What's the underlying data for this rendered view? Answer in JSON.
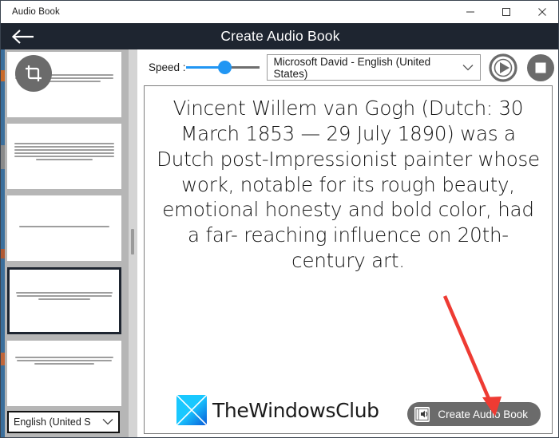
{
  "window": {
    "title": "Audio Book",
    "controls": {
      "minimize": "minimize-icon",
      "maximize": "maximize-icon",
      "close": "close-icon"
    }
  },
  "header": {
    "back_label": "back-arrow-icon",
    "title": "Create Audio Book"
  },
  "sidebar": {
    "crop_icon": "crop-icon",
    "thumbnails": [
      {
        "index": 1,
        "selected": false,
        "lines": [
          96,
          96,
          70
        ]
      },
      {
        "index": 2,
        "selected": false,
        "lines": [
          97,
          97,
          97,
          97,
          97,
          55
        ]
      },
      {
        "index": 3,
        "selected": false,
        "lines": [
          88
        ]
      },
      {
        "index": 4,
        "selected": true,
        "lines": [
          97,
          95,
          52
        ]
      },
      {
        "index": 5,
        "selected": false,
        "lines": [
          96,
          92,
          58
        ]
      }
    ],
    "language": {
      "value": "English (United S",
      "chevron": "chevron-down-icon"
    }
  },
  "toolbar": {
    "speed_label": "Speed :",
    "speed_value": 50,
    "voice": {
      "value": "Microsoft David - English (United States)",
      "chevron": "chevron-down-icon"
    },
    "play_button": "play-icon",
    "stop_button": "stop-icon"
  },
  "document": {
    "text": "Vincent Willem van Gogh (Dutch: 30 March 1853 — 29 July 1890) was a Dutch post-Impressionist painter whose work, notable for its rough beauty, emotional honesty and bold color, had a far- reaching influence on 20th-century art."
  },
  "footer": {
    "brand": "TheWindowsClub",
    "brand_logo": "thewindowsclub-logo",
    "create_button": {
      "label": "Create Audio Book",
      "icon": "audiobook-speaker-icon"
    },
    "annotation_arrow": "red-arrow-annotation"
  },
  "colors": {
    "header_bg": "#1e2530",
    "accent_blue": "#2196f3",
    "button_gray": "#6b6b6b",
    "arrow_red": "#ee3b33",
    "sidebar_bg": "#b6b6b6"
  }
}
